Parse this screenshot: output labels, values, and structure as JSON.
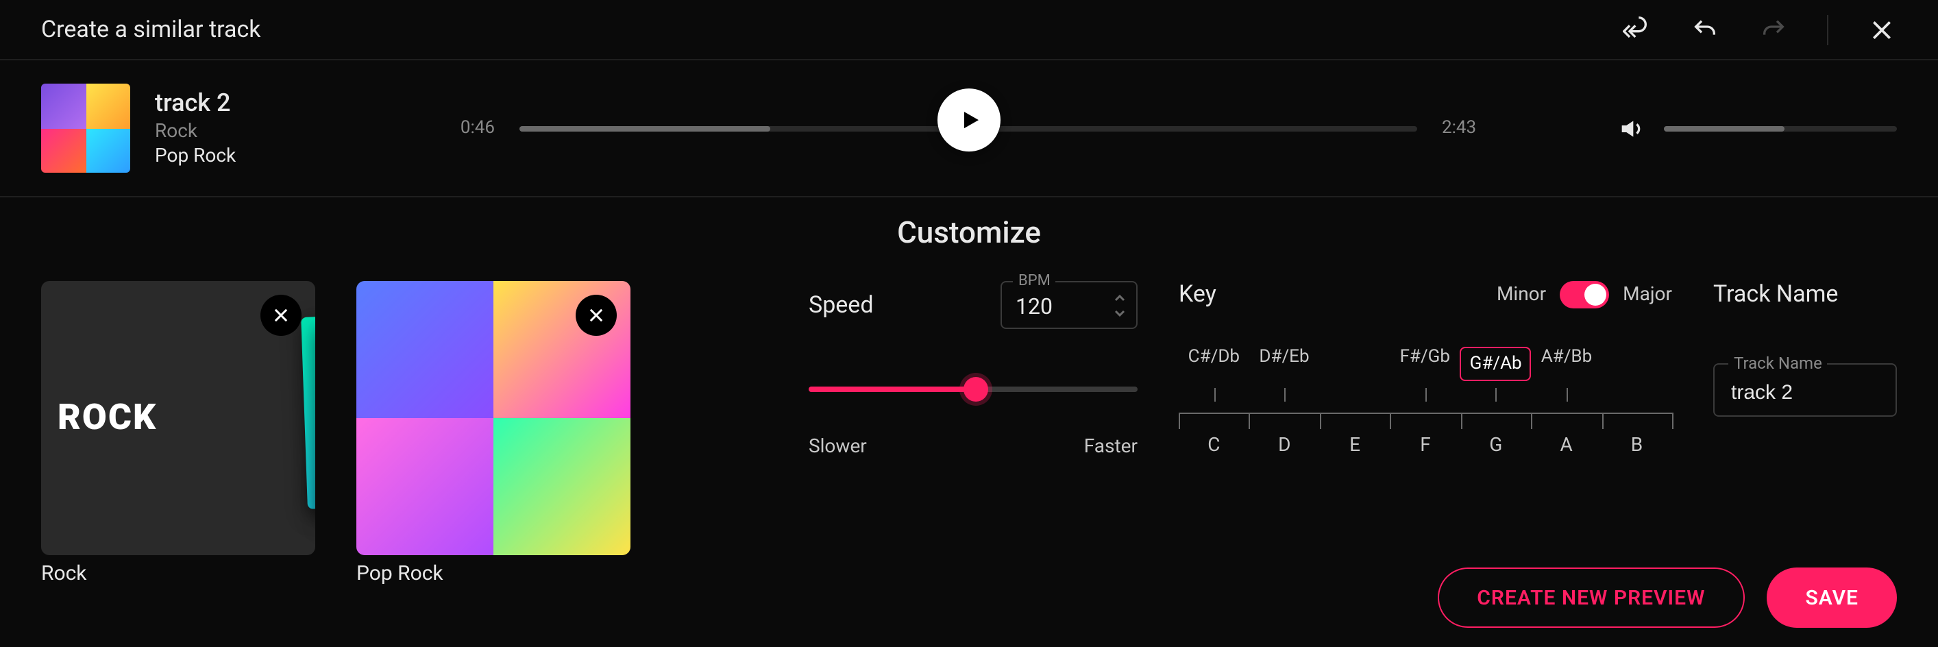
{
  "header": {
    "title": "Create a similar track"
  },
  "track": {
    "name": "track 2",
    "genre": "Rock",
    "subgenre": "Pop Rock",
    "current_time": "0:46",
    "duration": "2:43",
    "progress_pct": 28,
    "volume_pct": 52
  },
  "customize": {
    "heading": "Customize",
    "styles": [
      {
        "label": "Rock"
      },
      {
        "label": "Pop Rock"
      }
    ],
    "speed": {
      "label": "Speed",
      "bpm_label": "BPM",
      "bpm_value": "120",
      "slider_pct": 51,
      "slower": "Slower",
      "faster": "Faster"
    },
    "key": {
      "label": "Key",
      "minor": "Minor",
      "major": "Major",
      "mode": "Major",
      "sharps": [
        "C#/Db",
        "D#/Eb",
        "",
        "F#/Gb",
        "G#/Ab",
        "A#/Bb",
        ""
      ],
      "naturals": [
        "C",
        "D",
        "E",
        "F",
        "G",
        "A",
        "B"
      ],
      "selected": "G#/Ab"
    },
    "track_name": {
      "heading": "Track Name",
      "field_label": "Track Name",
      "value": "track 2"
    }
  },
  "footer": {
    "preview": "CREATE NEW PREVIEW",
    "save": "SAVE"
  }
}
